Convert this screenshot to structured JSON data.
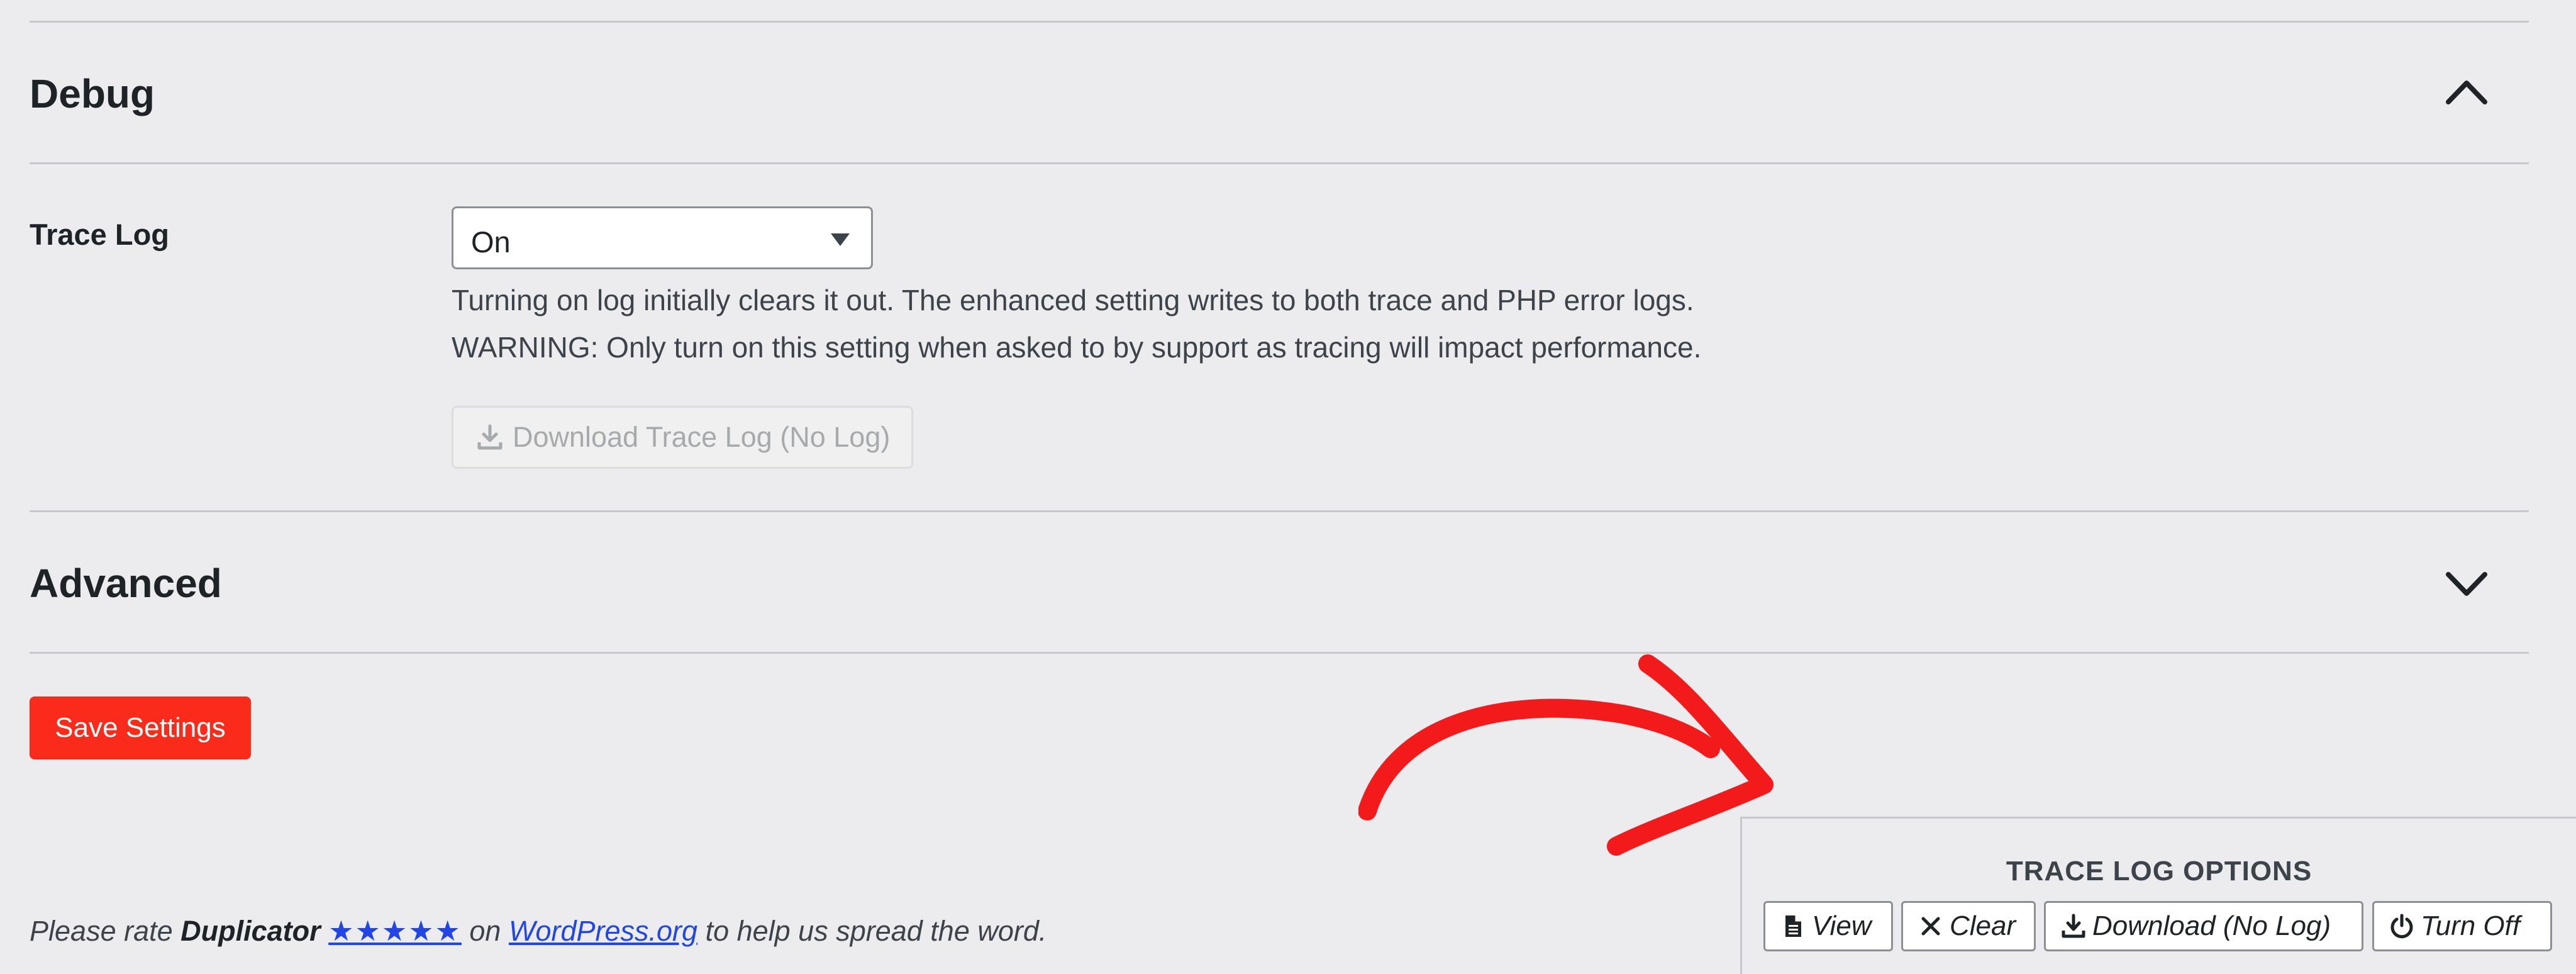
{
  "sections": {
    "debug": {
      "title": "Debug"
    },
    "advanced": {
      "title": "Advanced"
    }
  },
  "trace_log": {
    "label": "Trace Log",
    "selected": "On",
    "desc_line1": "Turning on log initially clears it out. The enhanced setting writes to both trace and PHP error logs.",
    "desc_line2": "WARNING: Only turn on this setting when asked to by support as tracing will impact performance.",
    "download_button": "Download Trace Log (No Log)"
  },
  "save_button": "Save Settings",
  "footer": {
    "prefix": "Please rate ",
    "product": "Duplicator",
    "stars": "★★★★★",
    "on": " on ",
    "link": "WordPress.org",
    "suffix": " to help us spread the word."
  },
  "trace_panel": {
    "title": "TRACE LOG OPTIONS",
    "view": "View",
    "clear": "Clear",
    "download": "Download (No Log)",
    "turn_off": "Turn Off"
  },
  "colors": {
    "accent_red": "#fb2b1b",
    "link_blue": "#2145e6",
    "annotation_red": "#f21a1a"
  },
  "icons": {
    "debug_toggle": "chevron-up-icon",
    "advanced_toggle": "chevron-down-icon",
    "download": "download-icon",
    "view": "file-icon",
    "clear": "close-icon",
    "turn_off": "power-icon"
  }
}
